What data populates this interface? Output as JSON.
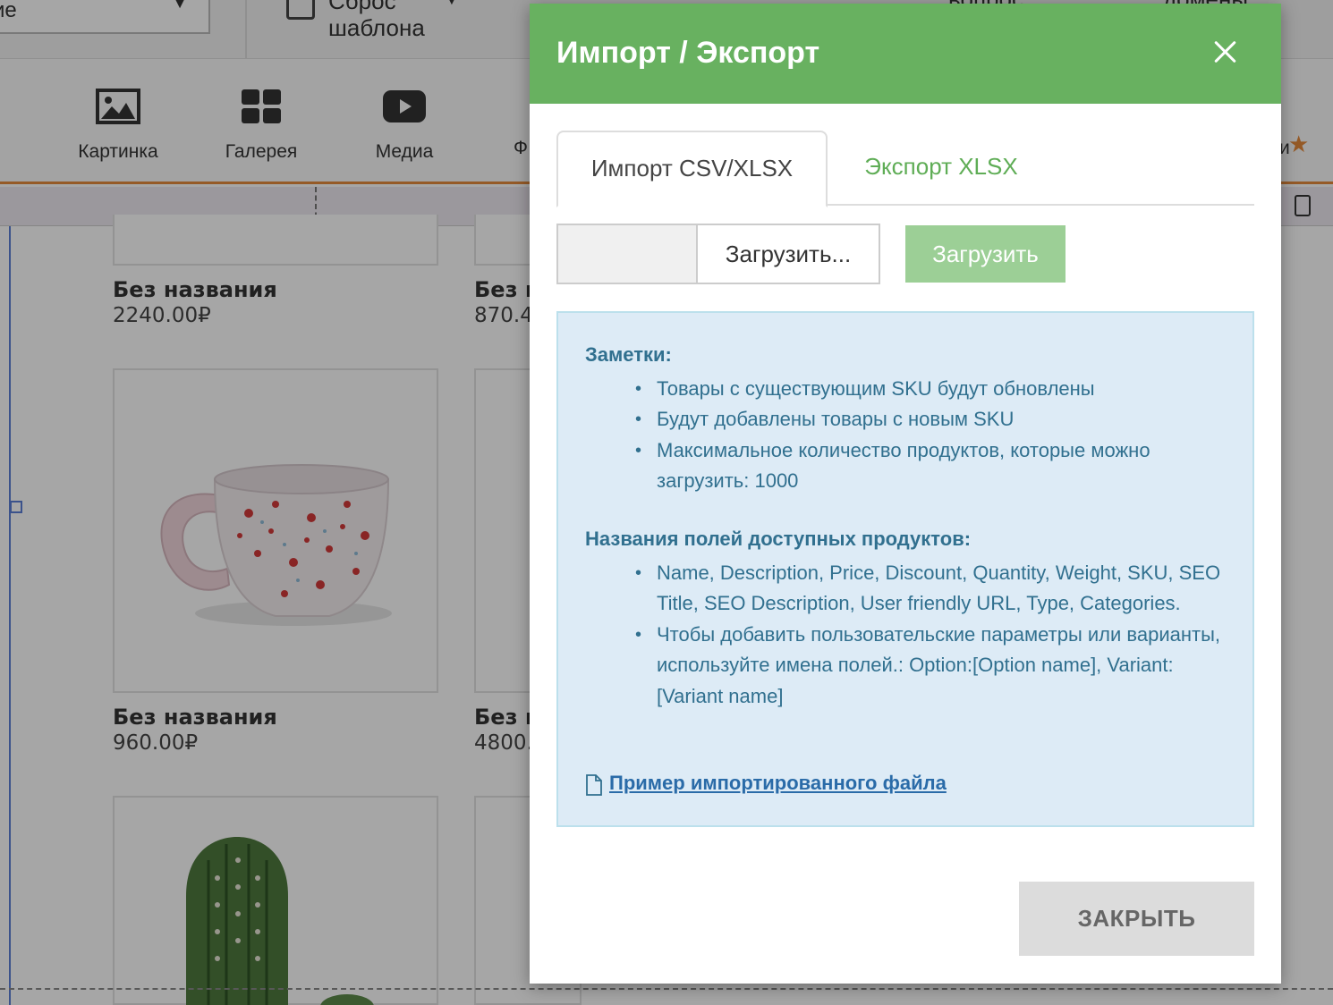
{
  "background": {
    "top_select_text": "ие",
    "reset_text": "Сброс шаблона",
    "top_mid_fragment": "вопрос",
    "top_right_fragment": "домены",
    "tools": [
      {
        "label": "Картинка",
        "icon": "image-icon"
      },
      {
        "label": "Галерея",
        "icon": "gallery-icon"
      },
      {
        "label": "Медиа",
        "icon": "media-icon"
      }
    ],
    "tool_fragment": "Ф",
    "tool_fragment_right": "и",
    "products": [
      {
        "name": "Без названия",
        "price": "2240.00₽"
      },
      {
        "name": "Без н",
        "price": "870.4"
      },
      {
        "name": "Без названия",
        "price": "960.00₽",
        "image": "cup"
      },
      {
        "name": "Без н",
        "price": "4800."
      }
    ]
  },
  "modal": {
    "title": "Импорт / Экспорт",
    "tabs": [
      {
        "label": "Импорт CSV/XLSX",
        "active": true
      },
      {
        "label": "Экспорт XLSX",
        "active": false
      }
    ],
    "file_button_label": "Загрузить...",
    "upload_button_label": "Загрузить",
    "notes_heading": "Заметки:",
    "notes": [
      "Товары с существующим SKU будут обновлены",
      "Будут добавлены товары с новым SKU",
      "Максимальное количество продуктов, которые можно загрузить: 1000"
    ],
    "fields_heading": "Названия полей доступных продуктов:",
    "fields": [
      "Name, Description, Price, Discount, Quantity, Weight, SKU, SEO Title, SEO Description, User friendly URL, Type, Categories.",
      "Чтобы добавить пользовательские параметры или варианты, используйте имена полей.: Option:[Option name], Variant:[Variant name]"
    ],
    "example_link": "Пример импортированного файла",
    "close_button_label": "ЗАКРЫТЬ",
    "colors": {
      "header": "#68b160",
      "tab_inactive": "#5fad56",
      "notes_bg": "#ddebf6",
      "notes_text": "#31708f"
    }
  }
}
